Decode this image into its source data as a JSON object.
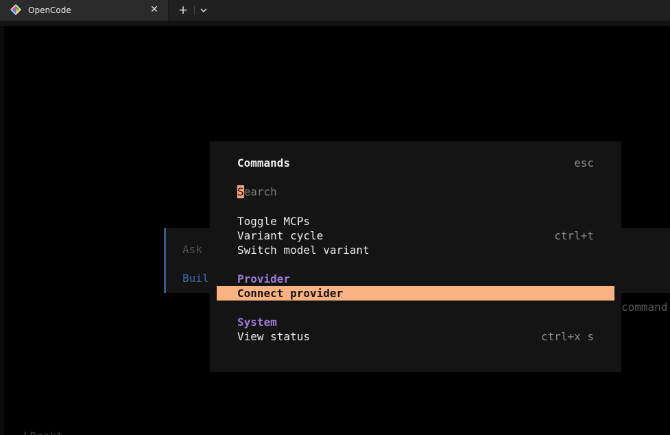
{
  "window": {
    "tab_title": "OpenCode",
    "close_glyph": "✕",
    "new_tab_glyph": "+"
  },
  "background": {
    "prompt_placeholder": "Ask",
    "agent_label": "Buil",
    "hint_text": "command",
    "bottom_text": "\\Deskt"
  },
  "modal": {
    "title": "Commands",
    "close_hint": "esc",
    "search": {
      "cursor_char": "S",
      "placeholder_rest": "earch"
    },
    "items": [
      {
        "label": "Toggle MCPs",
        "keys": ""
      },
      {
        "label": "Variant cycle",
        "keys": "ctrl+t"
      },
      {
        "label": "Switch model variant",
        "keys": ""
      }
    ],
    "groups": [
      {
        "name": "Provider",
        "items": [
          {
            "label": "Connect provider",
            "keys": "",
            "selected": true
          }
        ]
      },
      {
        "name": "System",
        "items": [
          {
            "label": "View status",
            "keys": "ctrl+x s"
          }
        ]
      }
    ]
  },
  "colors": {
    "accent_selection": "#fab283",
    "group_heading": "#9d7cd8",
    "agent_blue": "#3d6aa8"
  }
}
